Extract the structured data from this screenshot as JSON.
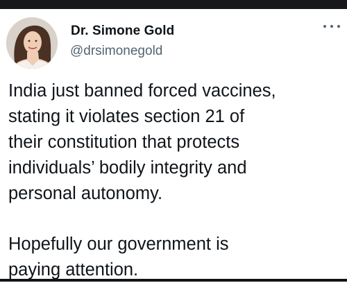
{
  "author": {
    "display_name": "Dr. Simone Gold",
    "handle": "@drsimonegold",
    "avatar_icon": "profile-photo"
  },
  "more_icon": "more-options-icon",
  "tweet": {
    "paragraph1_lines": [
      "India just banned forced vaccines,",
      "stating it violates section 21 of",
      "their constitution that protects",
      "individuals’ bodily integrity and",
      "personal autonomy."
    ],
    "paragraph2_lines": [
      "Hopefully our government is",
      "paying attention."
    ]
  },
  "colors": {
    "text": "#0f1419",
    "secondary": "#536471",
    "top_bar": "#16181c"
  }
}
